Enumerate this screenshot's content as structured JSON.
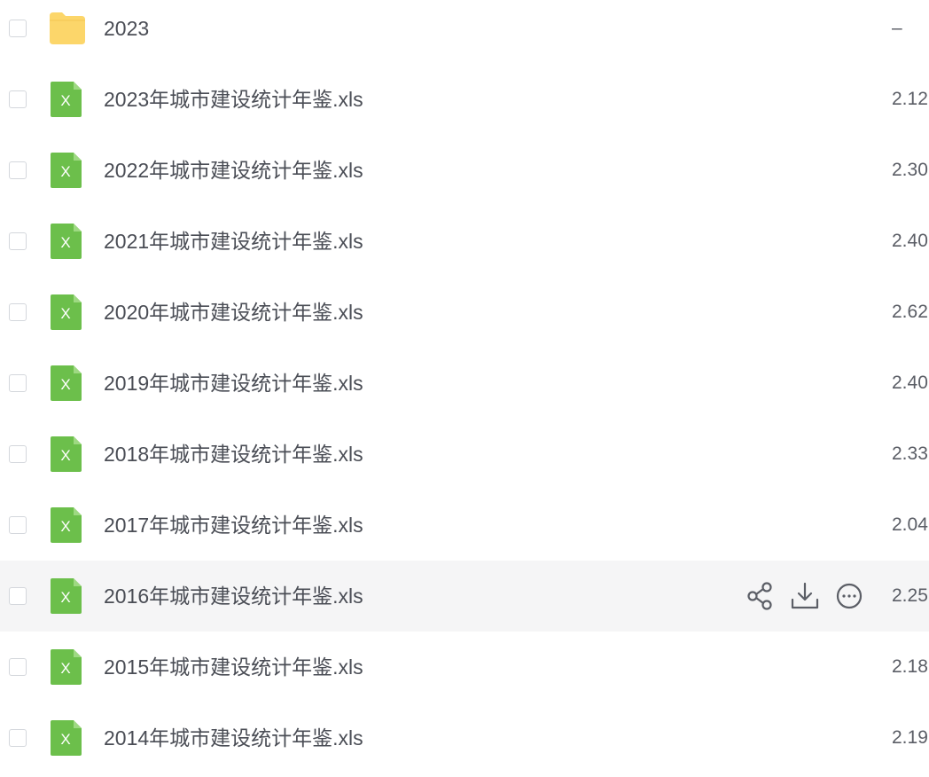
{
  "files": [
    {
      "name": "2023",
      "size": "–",
      "type": "folder",
      "icon": "folder-icon"
    },
    {
      "name": "2023年城市建设统计年鉴.xls",
      "size": "2.12",
      "type": "excel",
      "icon": "excel-file-icon"
    },
    {
      "name": "2022年城市建设统计年鉴.xls",
      "size": "2.30",
      "type": "excel",
      "icon": "excel-file-icon"
    },
    {
      "name": "2021年城市建设统计年鉴.xls",
      "size": "2.40",
      "type": "excel",
      "icon": "excel-file-icon"
    },
    {
      "name": "2020年城市建设统计年鉴.xls",
      "size": "2.62",
      "type": "excel",
      "icon": "excel-file-icon"
    },
    {
      "name": "2019年城市建设统计年鉴.xls",
      "size": "2.40",
      "type": "excel",
      "icon": "excel-file-icon"
    },
    {
      "name": "2018年城市建设统计年鉴.xls",
      "size": "2.33",
      "type": "excel",
      "icon": "excel-file-icon"
    },
    {
      "name": "2017年城市建设统计年鉴.xls",
      "size": "2.04",
      "type": "excel",
      "icon": "excel-file-icon"
    },
    {
      "name": "2016年城市建设统计年鉴.xls",
      "size": "2.25",
      "type": "excel",
      "icon": "excel-file-icon",
      "hovered": true
    },
    {
      "name": "2015年城市建设统计年鉴.xls",
      "size": "2.18",
      "type": "excel",
      "icon": "excel-file-icon"
    },
    {
      "name": "2014年城市建设统计年鉴.xls",
      "size": "2.19",
      "type": "excel",
      "icon": "excel-file-icon"
    }
  ],
  "row_actions": [
    {
      "name": "share",
      "icon": "share-icon"
    },
    {
      "name": "download",
      "icon": "download-icon"
    },
    {
      "name": "more",
      "icon": "more-icon"
    }
  ],
  "colors": {
    "folder": "#fcd66a",
    "excel": "#6cbf4b",
    "hover_bg": "#f5f5f6",
    "text": "#4a4d55",
    "icon": "#5b5e66"
  }
}
